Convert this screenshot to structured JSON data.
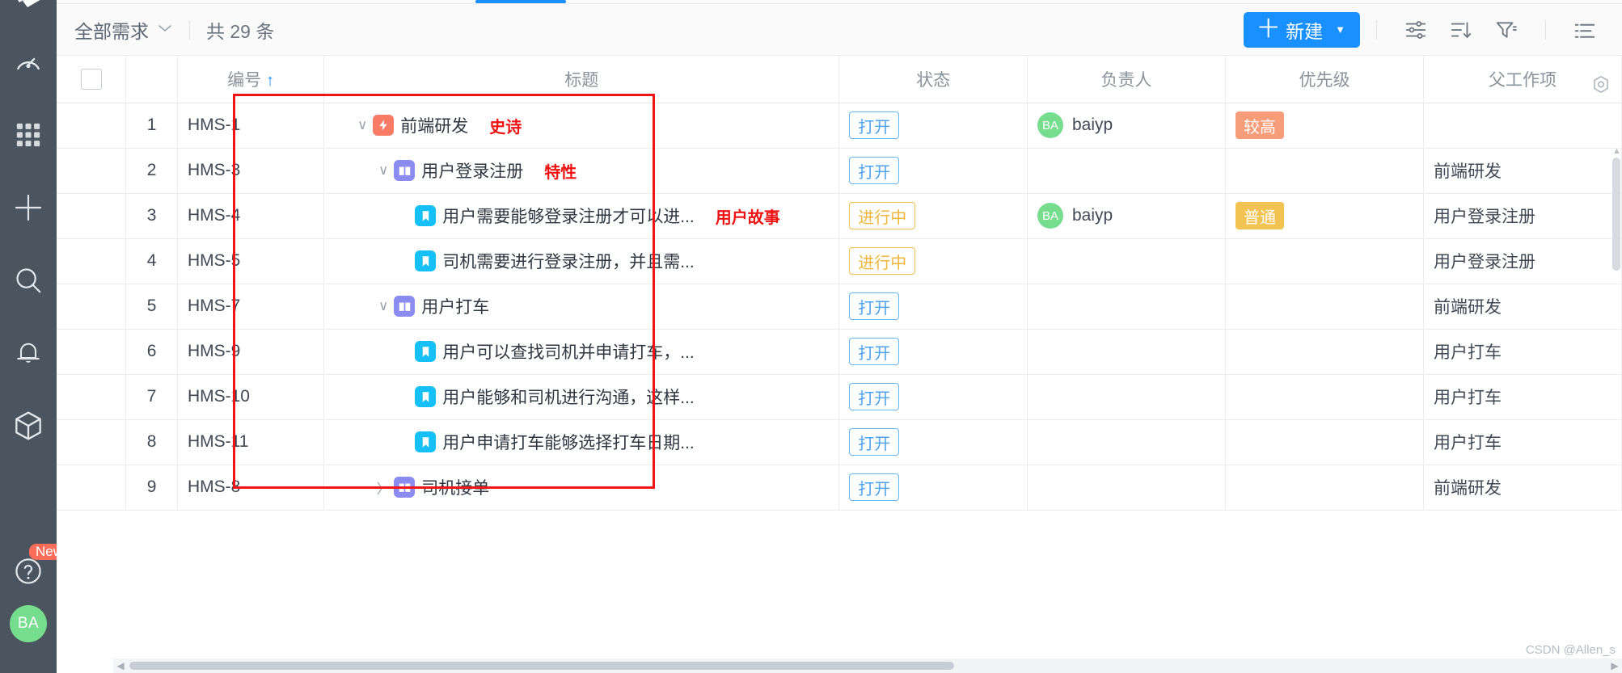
{
  "sidebar": {
    "items": [
      {
        "name": "logo-icon",
        "label": "Logo"
      },
      {
        "name": "dashboard-icon",
        "label": "仪表盘"
      },
      {
        "name": "apps-grid-icon",
        "label": "应用"
      },
      {
        "name": "add-icon",
        "label": "新建"
      },
      {
        "name": "search-icon",
        "label": "搜索"
      },
      {
        "name": "notification-bell-icon",
        "label": "通知"
      },
      {
        "name": "package-cube-icon",
        "label": "组件"
      },
      {
        "name": "help-question-icon",
        "label": "帮助"
      }
    ],
    "new_badge": "New",
    "avatar_initials": "BA",
    "background_color": "#4a5560"
  },
  "toolbar": {
    "scope_label": "全部需求",
    "scope_caret": "chevron-down-icon",
    "count_text": "共 29 条",
    "new_button_label": "新建",
    "new_button_plus": "十",
    "new_button_caret": "▼",
    "accent_color": "#1890ff",
    "icons": [
      {
        "name": "settings-sliders-icon",
        "label": "字段设置"
      },
      {
        "name": "sort-icon",
        "label": "排序"
      },
      {
        "name": "filter-funnel-icon",
        "label": "筛选"
      },
      {
        "name": "list-view-icon",
        "label": "视图"
      }
    ]
  },
  "table": {
    "columns": [
      {
        "key": "select",
        "label": ""
      },
      {
        "key": "index",
        "label": ""
      },
      {
        "key": "code",
        "label": "编号",
        "sort": "↑"
      },
      {
        "key": "title",
        "label": "标题"
      },
      {
        "key": "status",
        "label": "状态"
      },
      {
        "key": "owner",
        "label": "负责人"
      },
      {
        "key": "priority",
        "label": "优先级"
      },
      {
        "key": "parent",
        "label": "父工作项"
      }
    ],
    "gear_icon": "column-settings-icon",
    "rows": [
      {
        "index": "1",
        "code": "HMS-1",
        "indent": 0,
        "chevron": "∨",
        "icon": "epic",
        "title": "前端研发",
        "annotation": "史诗",
        "status": "打开",
        "status_style": "open",
        "owner": "baiyp",
        "owner_initials": "BA",
        "priority": "较高",
        "priority_style": "high",
        "parent": ""
      },
      {
        "index": "2",
        "code": "HMS-3",
        "indent": 1,
        "chevron": "∨",
        "icon": "feature",
        "title": "用户登录注册",
        "annotation": "特性",
        "status": "打开",
        "status_style": "open",
        "owner": "",
        "owner_initials": "",
        "priority": "",
        "priority_style": "",
        "parent": "前端研发"
      },
      {
        "index": "3",
        "code": "HMS-4",
        "indent": 2,
        "chevron": "",
        "icon": "story",
        "title": "用户需要能够登录注册才可以进...",
        "annotation": "用户故事",
        "status": "进行中",
        "status_style": "doing",
        "owner": "baiyp",
        "owner_initials": "BA",
        "priority": "普通",
        "priority_style": "normal",
        "parent": "用户登录注册"
      },
      {
        "index": "4",
        "code": "HMS-5",
        "indent": 2,
        "chevron": "",
        "icon": "story",
        "title": "司机需要进行登录注册，并且需...",
        "annotation": "",
        "status": "进行中",
        "status_style": "doing",
        "owner": "",
        "owner_initials": "",
        "priority": "",
        "priority_style": "",
        "parent": "用户登录注册"
      },
      {
        "index": "5",
        "code": "HMS-7",
        "indent": 1,
        "chevron": "∨",
        "icon": "feature",
        "title": "用户打车",
        "annotation": "",
        "status": "打开",
        "status_style": "open",
        "owner": "",
        "owner_initials": "",
        "priority": "",
        "priority_style": "",
        "parent": "前端研发"
      },
      {
        "index": "6",
        "code": "HMS-9",
        "indent": 2,
        "chevron": "",
        "icon": "story",
        "title": "用户可以查找司机并申请打车，...",
        "annotation": "",
        "status": "打开",
        "status_style": "open",
        "owner": "",
        "owner_initials": "",
        "priority": "",
        "priority_style": "",
        "parent": "用户打车"
      },
      {
        "index": "7",
        "code": "HMS-10",
        "indent": 2,
        "chevron": "",
        "icon": "story",
        "title": "用户能够和司机进行沟通，这样...",
        "annotation": "",
        "status": "打开",
        "status_style": "open",
        "owner": "",
        "owner_initials": "",
        "priority": "",
        "priority_style": "",
        "parent": "用户打车"
      },
      {
        "index": "8",
        "code": "HMS-11",
        "indent": 2,
        "chevron": "",
        "icon": "story",
        "title": "用户申请打车能够选择打车日期...",
        "annotation": "",
        "status": "打开",
        "status_style": "open",
        "owner": "",
        "owner_initials": "",
        "priority": "",
        "priority_style": "",
        "parent": "用户打车"
      },
      {
        "index": "9",
        "code": "HMS-8",
        "indent": 1,
        "chevron": "〉",
        "icon": "feature",
        "title": "司机接单",
        "annotation": "",
        "status": "打开",
        "status_style": "open",
        "owner": "",
        "owner_initials": "",
        "priority": "",
        "priority_style": "",
        "parent": "前端研发"
      }
    ]
  },
  "annotation": {
    "highlight_color": "#f01414",
    "labels": [
      "史诗",
      "特性",
      "用户故事"
    ]
  },
  "watermark": "CSDN @Allen_s"
}
